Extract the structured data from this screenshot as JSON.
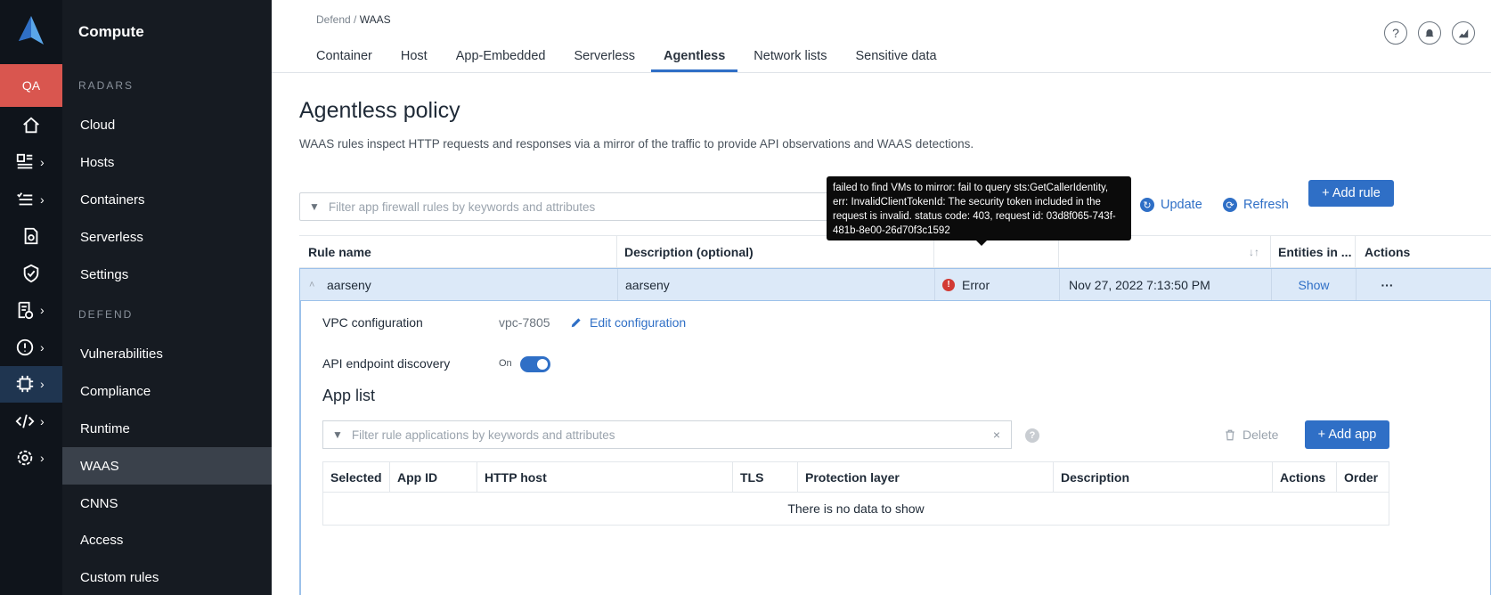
{
  "rail": {
    "qa_label": "QA",
    "icons": [
      "home-icon",
      "dashboard-icon",
      "list-icon",
      "report-icon",
      "shield-icon",
      "document-check-icon",
      "alert-icon",
      "chip-icon",
      "code-icon",
      "gear-icon"
    ]
  },
  "menu": {
    "title": "Compute",
    "radars_label": "RADARS",
    "radars": [
      "Cloud",
      "Hosts",
      "Containers",
      "Serverless",
      "Settings"
    ],
    "defend_label": "DEFEND",
    "defend": [
      "Vulnerabilities",
      "Compliance",
      "Runtime",
      "WAAS",
      "CNNS",
      "Access",
      "Custom rules"
    ],
    "active_item": "WAAS"
  },
  "breadcrumb": {
    "parent": "Defend",
    "separator": " / ",
    "current": "WAAS"
  },
  "tabs": [
    "Container",
    "Host",
    "App-Embedded",
    "Serverless",
    "Agentless",
    "Network lists",
    "Sensitive data"
  ],
  "active_tab": "Agentless",
  "page": {
    "title": "Agentless policy",
    "description": "WAAS rules inspect HTTP requests and responses via a mirror of the traffic to provide API observations and WAAS detections."
  },
  "toolbar": {
    "filter_placeholder": "Filter app firewall rules by keywords and attributes",
    "update_label": "Update",
    "refresh_label": "Refresh",
    "add_rule_label": "+ Add rule"
  },
  "tooltip": {
    "text": "failed to find VMs to mirror: fail to query sts:GetCallerIdentity, err: InvalidClientTokenId: The security token included in the request is invalid. status code: 403, request id: 03d8f065-743f-481b-8e00-26d70f3c1592"
  },
  "rules_table": {
    "headers": {
      "rule_name": "Rule name",
      "description": "Description (optional)",
      "entities": "Entities in ...",
      "actions": "Actions"
    },
    "row": {
      "rule_name": "aarseny",
      "description": "aarseny",
      "status": "Error",
      "modified": "Nov 27, 2022 7:13:50 PM",
      "entities_link": "Show",
      "actions": "···"
    }
  },
  "details": {
    "vpc_label": "VPC configuration",
    "vpc_value": "vpc-7805",
    "edit_label": "Edit configuration",
    "api_label": "API endpoint discovery",
    "api_toggle_label": "On",
    "api_enabled": true
  },
  "app_list": {
    "title": "App list",
    "filter_placeholder": "Filter rule applications by keywords and attributes",
    "delete_label": "Delete",
    "add_app_label": "+ Add app",
    "headers": [
      "Selected",
      "App ID",
      "HTTP host",
      "TLS",
      "Protection layer",
      "Description",
      "Actions",
      "Order"
    ],
    "empty_text": "There is no data to show"
  },
  "colors": {
    "accent": "#2f6fc6",
    "error": "#d23a34",
    "qa": "#d9564f",
    "sidebar": "#161b22"
  }
}
